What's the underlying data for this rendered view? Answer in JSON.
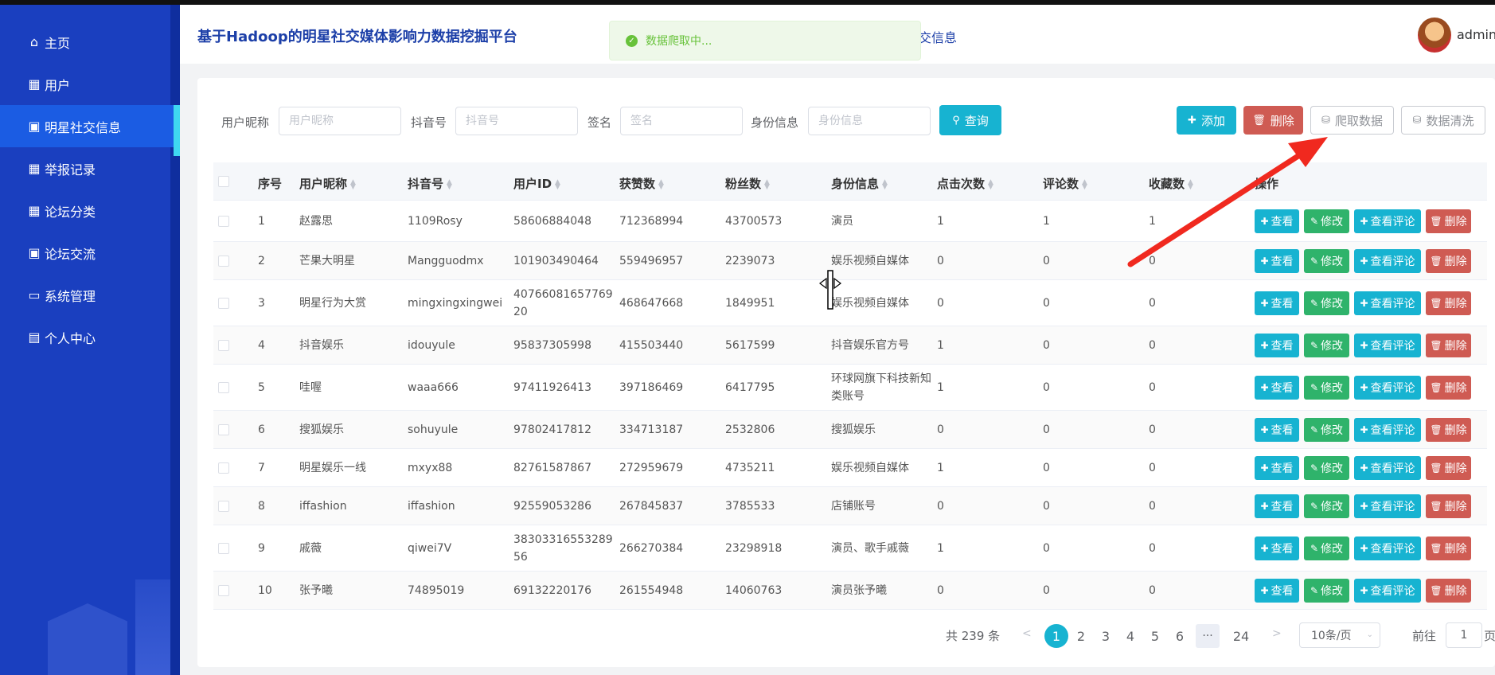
{
  "app": {
    "title": "基于Hadoop的明星社交媒体影响力数据挖掘平台",
    "header_fragment": "交信息",
    "username": "admin"
  },
  "toast": {
    "text": "数据爬取中..."
  },
  "sidebar": {
    "items": [
      {
        "label": "主页",
        "icon": "home-icon",
        "active": false
      },
      {
        "label": "用户",
        "icon": "grid-icon",
        "active": false
      },
      {
        "label": "明星社交信息",
        "icon": "clipboard-icon",
        "active": true
      },
      {
        "label": "举报记录",
        "icon": "grid-icon",
        "active": false
      },
      {
        "label": "论坛分类",
        "icon": "grid-icon",
        "active": false
      },
      {
        "label": "论坛交流",
        "icon": "briefcase-icon",
        "active": false
      },
      {
        "label": "系统管理",
        "icon": "monitor-icon",
        "active": false
      },
      {
        "label": "个人中心",
        "icon": "card-icon",
        "active": false
      }
    ]
  },
  "search": {
    "nickname_label": "用户昵称",
    "nickname_placeholder": "用户昵称",
    "douyin_label": "抖音号",
    "douyin_placeholder": "抖音号",
    "signature_label": "签名",
    "signature_placeholder": "签名",
    "identity_label": "身份信息",
    "identity_placeholder": "身份信息",
    "query_label": "查询"
  },
  "toolbar": {
    "add_label": "添加",
    "delete_label": "删除",
    "crawl_label": "爬取数据",
    "clean_label": "数据清洗"
  },
  "table": {
    "headers": [
      "序号",
      "用户昵称",
      "抖音号",
      "用户ID",
      "获赞数",
      "粉丝数",
      "身份信息",
      "点击次数",
      "评论数",
      "收藏数",
      "操作"
    ],
    "actions": {
      "view": "查看",
      "edit": "修改",
      "view_comments": "查看评论",
      "delete": "删除"
    },
    "rows": [
      {
        "index": "1",
        "nickname": "赵露思",
        "douyin": "1109Rosy",
        "uid": "58606884048",
        "likes": "712368994",
        "fans": "43700573",
        "identity": "演员",
        "clicks": "1",
        "comments": "1",
        "favorites": "1"
      },
      {
        "index": "2",
        "nickname": "芒果大明星",
        "douyin": "Mangguodmx",
        "uid": "101903490464",
        "likes": "559496957",
        "fans": "2239073",
        "identity": "娱乐视频自媒体",
        "clicks": "0",
        "comments": "0",
        "favorites": "0"
      },
      {
        "index": "3",
        "nickname": "明星行为大赏",
        "douyin": "mingxingxingwei",
        "uid": "4076608165776920",
        "likes": "468647668",
        "fans": "1849951",
        "identity": "娱乐视频自媒体",
        "clicks": "0",
        "comments": "0",
        "favorites": "0"
      },
      {
        "index": "4",
        "nickname": "抖音娱乐",
        "douyin": "idouyule",
        "uid": "95837305998",
        "likes": "415503440",
        "fans": "5617599",
        "identity": "抖音娱乐官方号",
        "clicks": "1",
        "comments": "0",
        "favorites": "0"
      },
      {
        "index": "5",
        "nickname": "哇喔",
        "douyin": "waaa666",
        "uid": "97411926413",
        "likes": "397186469",
        "fans": "6417795",
        "identity": "环球网旗下科技新知类账号",
        "clicks": "1",
        "comments": "0",
        "favorites": "0"
      },
      {
        "index": "6",
        "nickname": "搜狐娱乐",
        "douyin": "sohuyule",
        "uid": "97802417812",
        "likes": "334713187",
        "fans": "2532806",
        "identity": "搜狐娱乐",
        "clicks": "0",
        "comments": "0",
        "favorites": "0"
      },
      {
        "index": "7",
        "nickname": "明星娱乐一线",
        "douyin": "mxyx88",
        "uid": "82761587867",
        "likes": "272959679",
        "fans": "4735211",
        "identity": "娱乐视频自媒体",
        "clicks": "1",
        "comments": "0",
        "favorites": "0"
      },
      {
        "index": "8",
        "nickname": "iffashion",
        "douyin": "iffashion",
        "uid": "92559053286",
        "likes": "267845837",
        "fans": "3785533",
        "identity": "店铺账号",
        "clicks": "0",
        "comments": "0",
        "favorites": "0"
      },
      {
        "index": "9",
        "nickname": "戚薇",
        "douyin": "qiwei7V",
        "uid": "3830331655328956",
        "likes": "266270384",
        "fans": "23298918",
        "identity": "演员、歌手戚薇",
        "clicks": "1",
        "comments": "0",
        "favorites": "0"
      },
      {
        "index": "10",
        "nickname": "张予曦",
        "douyin": "74895019",
        "uid": "69132220176",
        "likes": "261554948",
        "fans": "14060763",
        "identity": "演员张予曦",
        "clicks": "0",
        "comments": "0",
        "favorites": "0"
      }
    ]
  },
  "pagination": {
    "total_text": "共 239 条",
    "prev": "<",
    "next": ">",
    "pages": [
      "1",
      "2",
      "3",
      "4",
      "5",
      "6"
    ],
    "more": "···",
    "last": "24",
    "current": "1",
    "page_size": "10条/页",
    "goto_label": "前往",
    "goto_value": "1",
    "page_suffix": "页"
  },
  "colors": {
    "sidebar": "#1a3fbf",
    "accent": "#17b3d1",
    "danger": "#cf5b53",
    "success": "#2fb36b",
    "annotation_arrow": "#f0291f"
  }
}
